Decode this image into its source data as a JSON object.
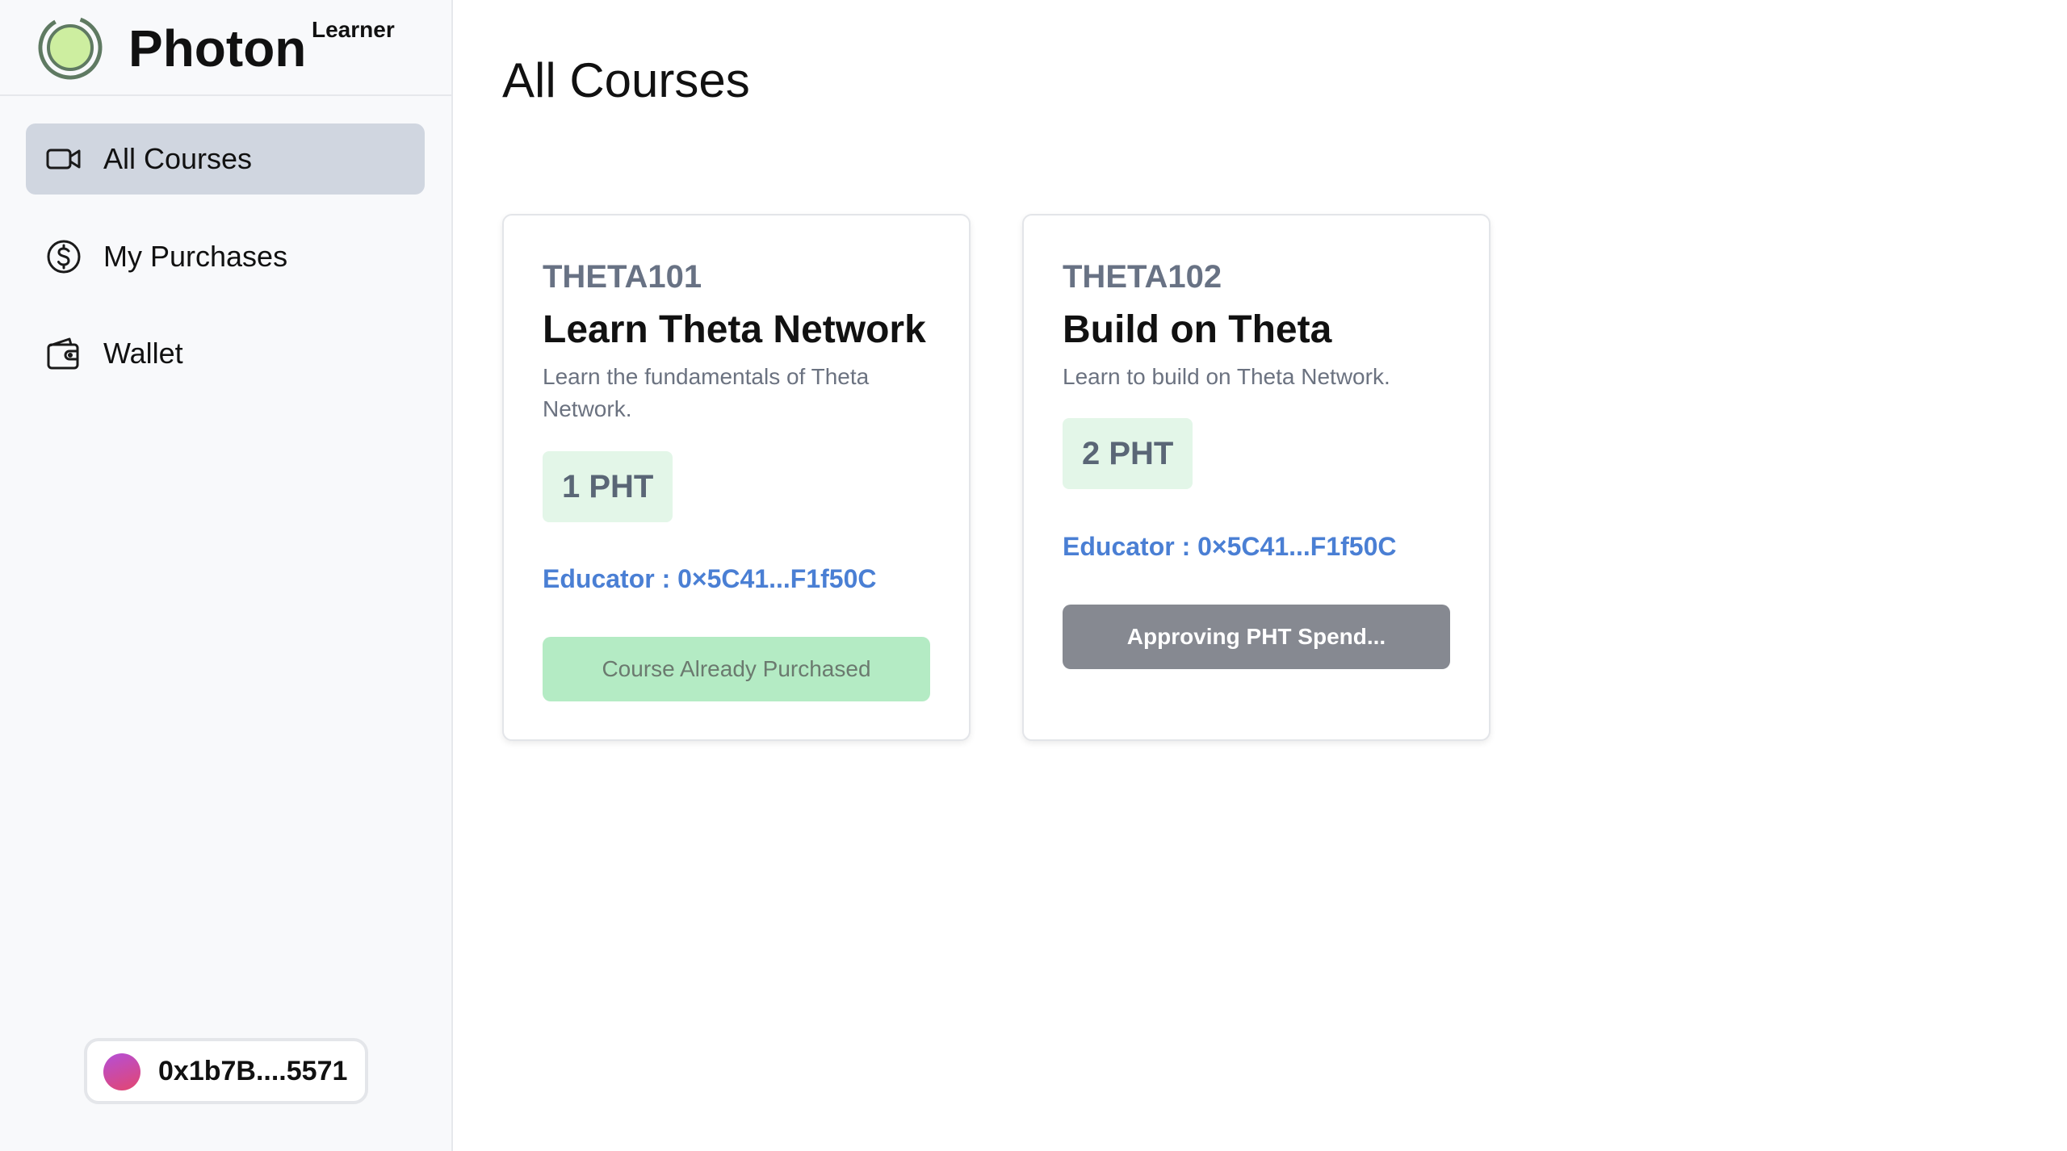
{
  "brand": {
    "name": "Photon",
    "role": "Learner"
  },
  "sidebar": {
    "items": [
      {
        "label": "All Courses",
        "icon": "video-camera-icon",
        "active": true
      },
      {
        "label": "My Purchases",
        "icon": "dollar-circle-icon",
        "active": false
      },
      {
        "label": "Wallet",
        "icon": "wallet-icon",
        "active": false
      }
    ]
  },
  "wallet": {
    "address": "0x1b7B....5571"
  },
  "main": {
    "title": "All Courses",
    "courses": [
      {
        "code": "THETA101",
        "title": "Learn Theta Network",
        "description": "Learn the fundamentals of Theta Network.",
        "price": "1 PHT",
        "educator": "Educator : 0×5C41...F1f50C",
        "button": "Course Already Purchased"
      },
      {
        "code": "THETA102",
        "title": "Build on Theta",
        "description": "Learn to build on Theta Network.",
        "price": "2 PHT",
        "educator": "Educator : 0×5C41...F1f50C",
        "button": "Approving PHT Spend..."
      }
    ]
  },
  "colors": {
    "sidebar_bg": "#f8f9fb",
    "active_nav_bg": "#d0d6e0",
    "price_badge_bg": "#e3f6e8",
    "educator_link": "#4a7fd4",
    "purchased_button_bg": "#b4ebc4",
    "approving_button_bg": "#868991",
    "logo_fill": "#cdeea0",
    "logo_ring": "#5f7a62"
  }
}
